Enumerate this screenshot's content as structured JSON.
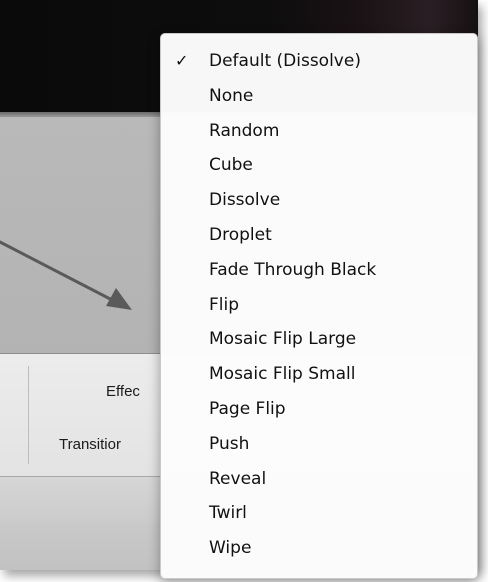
{
  "menu": {
    "items": [
      {
        "label": "Default (Dissolve)",
        "checked": true
      },
      {
        "label": "None",
        "checked": false
      },
      {
        "label": "Random",
        "checked": false
      },
      {
        "label": "Cube",
        "checked": false
      },
      {
        "label": "Dissolve",
        "checked": false
      },
      {
        "label": "Droplet",
        "checked": false
      },
      {
        "label": "Fade Through Black",
        "checked": false
      },
      {
        "label": "Flip",
        "checked": false
      },
      {
        "label": "Mosaic Flip Large",
        "checked": false
      },
      {
        "label": "Mosaic Flip Small",
        "checked": false
      },
      {
        "label": "Page Flip",
        "checked": false
      },
      {
        "label": "Push",
        "checked": false
      },
      {
        "label": "Reveal",
        "checked": false
      },
      {
        "label": "Twirl",
        "checked": false
      },
      {
        "label": "Wipe",
        "checked": false
      }
    ],
    "check_glyph": "✓"
  },
  "panel": {
    "effect_label": "Effec",
    "transition_label": "Transitior"
  },
  "colors": {
    "arrow": "#5a5a5a",
    "menu_bg": "#fcfcfc",
    "dark_bg": "#0a0a0a"
  }
}
